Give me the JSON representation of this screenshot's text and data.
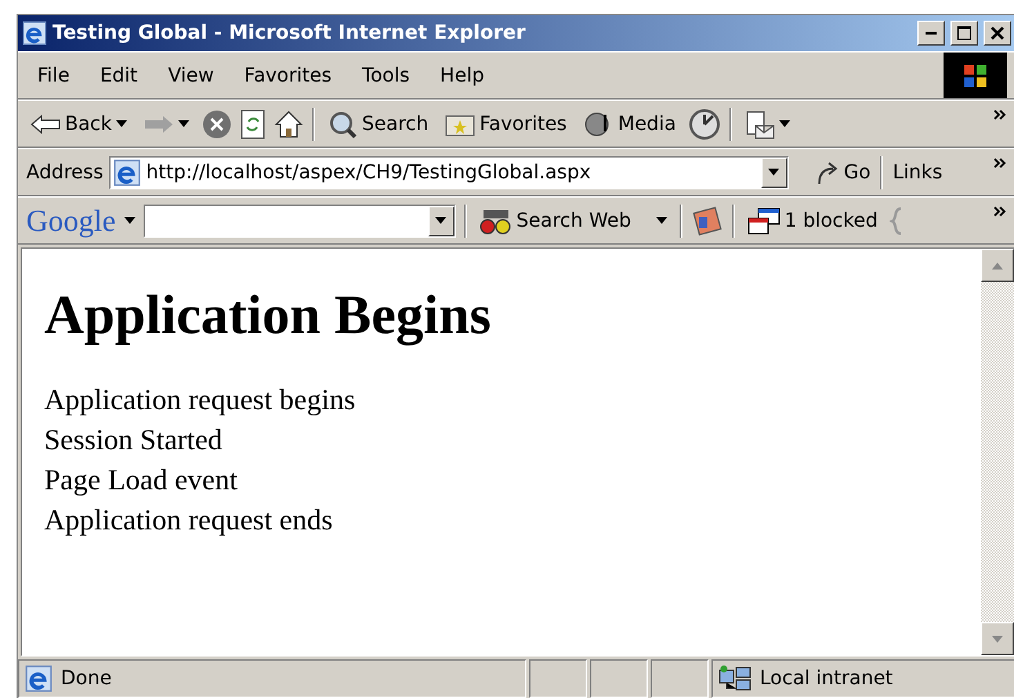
{
  "window": {
    "title": "Testing Global - Microsoft Internet Explorer"
  },
  "menu": [
    "File",
    "Edit",
    "View",
    "Favorites",
    "Tools",
    "Help"
  ],
  "toolbar": [
    {
      "kind": "back",
      "label": "Back"
    },
    {
      "kind": "forward"
    },
    {
      "kind": "stop"
    },
    {
      "kind": "refresh"
    },
    {
      "kind": "home"
    },
    {
      "kind": "search",
      "label": "Search"
    },
    {
      "kind": "favorites",
      "label": "Favorites"
    },
    {
      "kind": "media",
      "label": "Media"
    },
    {
      "kind": "history"
    },
    {
      "kind": "mail"
    }
  ],
  "address": {
    "label": "Address",
    "value": "http://localhost/aspex/CH9/TestingGlobal.aspx",
    "go": "Go",
    "links": "Links"
  },
  "google": {
    "logo": "Google",
    "search_web": "Search Web",
    "blocked": "1 blocked"
  },
  "page": {
    "heading": "Application Begins",
    "lines": [
      "Application request begins",
      "Session Started",
      "Page Load event",
      "Application request ends"
    ]
  },
  "status_bar": {
    "text": "Done",
    "zone": "Local intranet"
  }
}
